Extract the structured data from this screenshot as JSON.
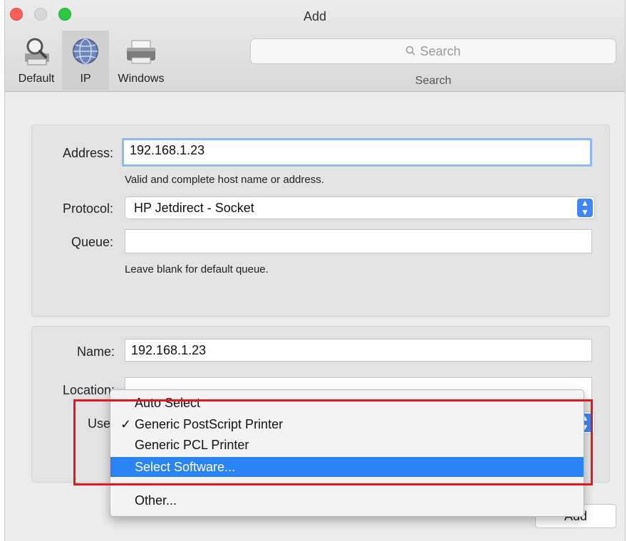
{
  "window": {
    "title": "Add"
  },
  "toolbar": {
    "tools": [
      {
        "label": "Default",
        "icon": "magnifier-printer-icon"
      },
      {
        "label": "IP",
        "icon": "globe-icon"
      },
      {
        "label": "Windows",
        "icon": "printer-icon"
      }
    ],
    "selected": "IP",
    "search_placeholder": "Search",
    "search_label": "Search"
  },
  "form": {
    "address_label": "Address:",
    "address_value": "192.168.1.23",
    "address_hint": "Valid and complete host name or address.",
    "protocol_label": "Protocol:",
    "protocol_value": "HP Jetdirect - Socket",
    "queue_label": "Queue:",
    "queue_value": "",
    "queue_hint": "Leave blank for default queue.",
    "name_label": "Name:",
    "name_value": "192.168.1.23",
    "location_label": "Location:",
    "use_label": "Use"
  },
  "menu": {
    "items": [
      {
        "label": "Auto Select",
        "checked": false,
        "highlighted": false
      },
      {
        "label": "Generic PostScript Printer",
        "checked": true,
        "highlighted": false
      },
      {
        "label": "Generic PCL Printer",
        "checked": false,
        "highlighted": false
      },
      {
        "label": "Select Software...",
        "checked": false,
        "highlighted": true
      },
      {
        "label": "Other...",
        "checked": false,
        "highlighted": false
      }
    ],
    "check_glyph": "✓"
  },
  "buttons": {
    "add": "Add"
  },
  "colors": {
    "accent": "#2a83f4",
    "annotation": "#e8141a",
    "focus_ring": "#8fb8ef"
  }
}
